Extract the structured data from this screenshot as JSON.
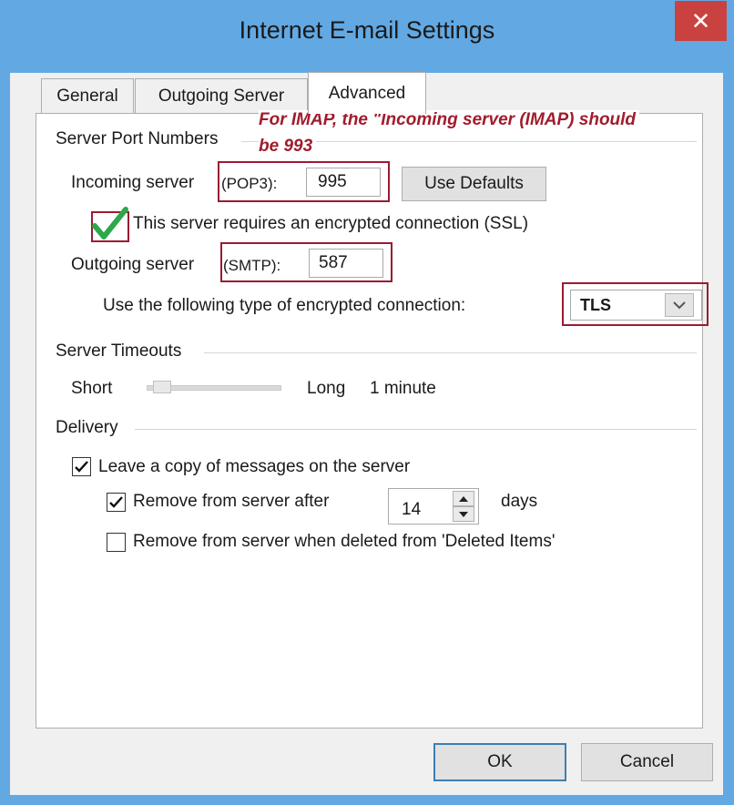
{
  "window": {
    "title": "Internet E-mail Settings",
    "close_glyph": "✕"
  },
  "tabs": [
    {
      "label": "General"
    },
    {
      "label": "Outgoing Server"
    },
    {
      "label": "Advanced"
    }
  ],
  "annotation": {
    "line1": "For IMAP, the \"Incoming server (IMAP) should",
    "line2": "be 993",
    "color": "#a01c2c"
  },
  "ports": {
    "group_label": "Server Port Numbers",
    "incoming_label": "Incoming server",
    "incoming_protocol": "(POP3):",
    "incoming_value": "995",
    "use_defaults_label": "Use Defaults",
    "ssl_label": "This server requires an encrypted connection (SSL)",
    "ssl_checked": true,
    "outgoing_label": "Outgoing server",
    "outgoing_protocol": "(SMTP):",
    "outgoing_value": "587",
    "encryption_label": "Use the following type of encrypted connection:",
    "encryption_value": "TLS"
  },
  "timeouts": {
    "group_label": "Server Timeouts",
    "short_label": "Short",
    "long_label": "Long",
    "value_label": "1 minute",
    "level": 0.0
  },
  "delivery": {
    "group_label": "Delivery",
    "leave_copy_label": "Leave a copy of messages on the server",
    "leave_copy_checked": true,
    "remove_after_label": "Remove from server after",
    "remove_after_checked": true,
    "remove_after_days": "14",
    "days_label": "days",
    "remove_deleted_label": "Remove from server when deleted from 'Deleted Items'",
    "remove_deleted_checked": false
  },
  "footer": {
    "ok_label": "OK",
    "cancel_label": "Cancel"
  },
  "icons": [
    "close-icon",
    "green-checkmark-icon",
    "dropdown-arrow-icon",
    "spin-up-icon",
    "spin-down-icon",
    "checkbox-check-icon"
  ],
  "colors": {
    "titlebar": "#62a9e4",
    "annotation_red": "#9b1b30",
    "check_green": "#2da84a"
  }
}
